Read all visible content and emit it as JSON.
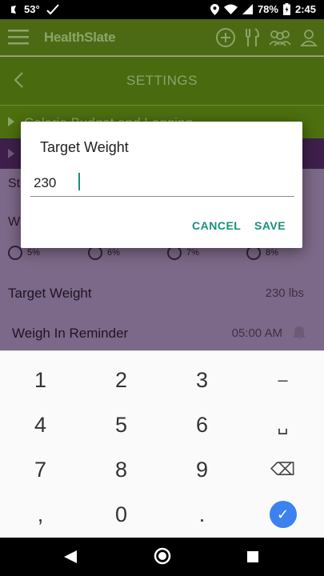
{
  "status_bar": {
    "temperature": "53°",
    "battery": "78%",
    "time": "2:45"
  },
  "app": {
    "brand": "HealthSlate",
    "screen_title": "SETTINGS",
    "sections": {
      "calorie": "Calorie Budget and Logging"
    },
    "weight_panel": {
      "peek_row_1": "St",
      "peek_row_2": "W",
      "rates": [
        "5%",
        "6%",
        "7%",
        "8%"
      ],
      "target_weight_label": "Target Weight",
      "target_weight_value": "230 lbs",
      "reminder_label": "Weigh In Reminder",
      "reminder_time": "05:00 AM"
    }
  },
  "dialog": {
    "title": "Target Weight",
    "value": "230",
    "cancel_label": "CANCEL",
    "save_label": "SAVE"
  },
  "keyboard": {
    "rows": [
      [
        "1",
        "2",
        "3",
        "–"
      ],
      [
        "4",
        "5",
        "6",
        "␣"
      ],
      [
        "7",
        "8",
        "9",
        "⌫"
      ],
      [
        ",",
        "0",
        ".",
        "✓"
      ]
    ]
  },
  "colors": {
    "accent_teal": "#1a8f7b",
    "appbar_green": "#4c6a14",
    "weight_section_purple": "#3e1f4b",
    "done_blue": "#3b82f0"
  }
}
